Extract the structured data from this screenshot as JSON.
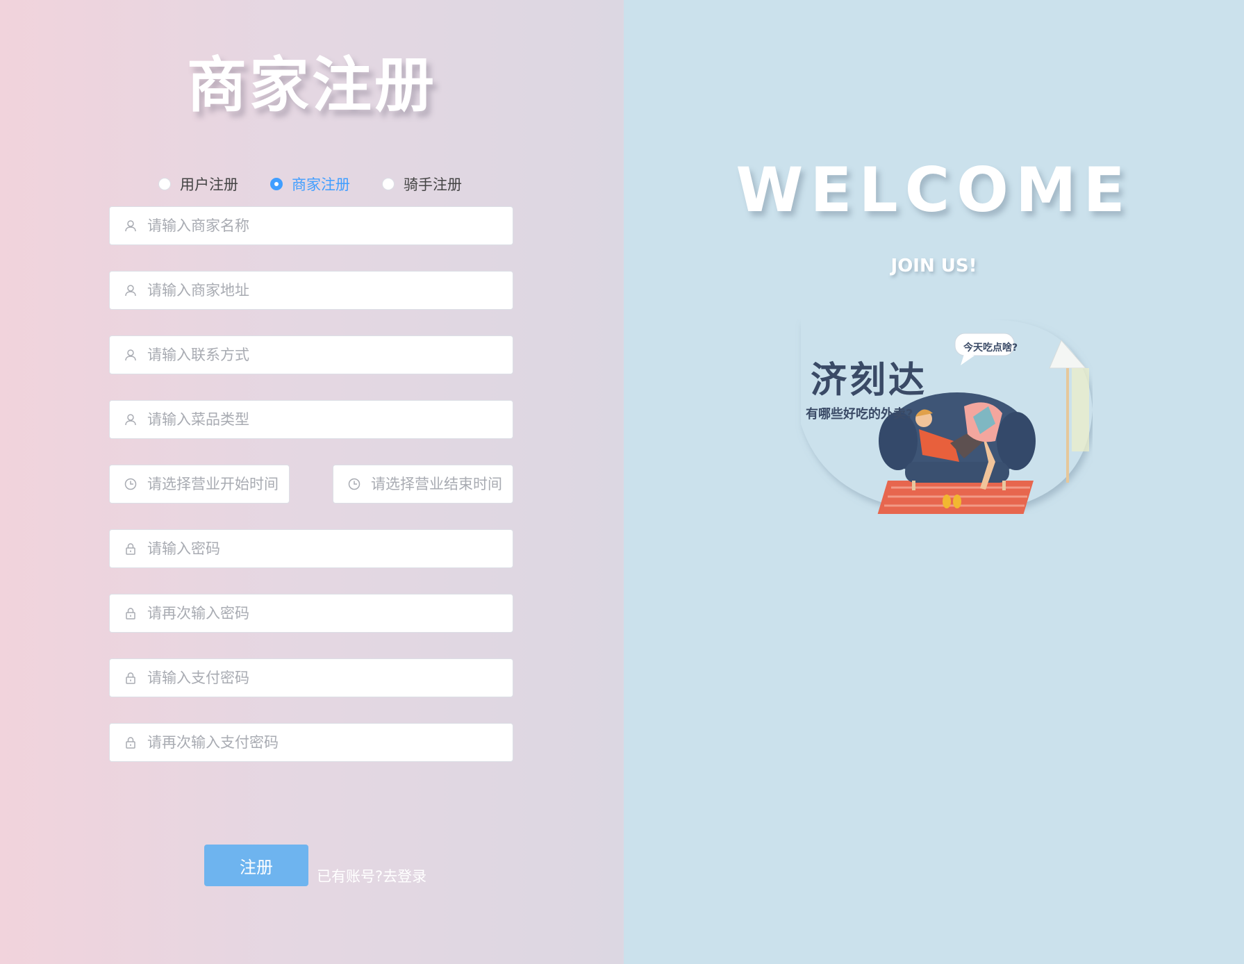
{
  "register": {
    "title": "商家注册",
    "roles": [
      {
        "label": "用户注册",
        "checked": false
      },
      {
        "label": "商家注册",
        "checked": true
      },
      {
        "label": "骑手注册",
        "checked": false
      }
    ],
    "fields": {
      "shop_name": {
        "placeholder": "请输入商家名称",
        "icon": "user-icon"
      },
      "shop_address": {
        "placeholder": "请输入商家地址",
        "icon": "user-icon"
      },
      "contact": {
        "placeholder": "请输入联系方式",
        "icon": "user-icon"
      },
      "dish_type": {
        "placeholder": "请输入菜品类型",
        "icon": "user-icon"
      },
      "open_time": {
        "placeholder": "请选择营业开始时间",
        "icon": "clock-icon"
      },
      "close_time": {
        "placeholder": "请选择营业结束时间",
        "icon": "clock-icon"
      },
      "password": {
        "placeholder": "请输入密码",
        "icon": "lock-icon"
      },
      "password_confirm": {
        "placeholder": "请再次输入密码",
        "icon": "lock-icon"
      },
      "pay_password": {
        "placeholder": "请输入支付密码",
        "icon": "lock-icon"
      },
      "pay_password_confirm": {
        "placeholder": "请再次输入支付密码",
        "icon": "lock-icon"
      }
    },
    "submit_label": "注册",
    "login_link": "已有账号?去登录"
  },
  "welcome": {
    "heading": "WELCOME",
    "subheading": "JOIN US!",
    "banner": {
      "brand": "济刻达",
      "tagline": "有哪些好吃的外卖?",
      "bubble": "今天吃点啥?"
    }
  },
  "colors": {
    "accent": "#409eff",
    "button": "#6eb4ef",
    "right_bg": "#cbe1ec"
  }
}
